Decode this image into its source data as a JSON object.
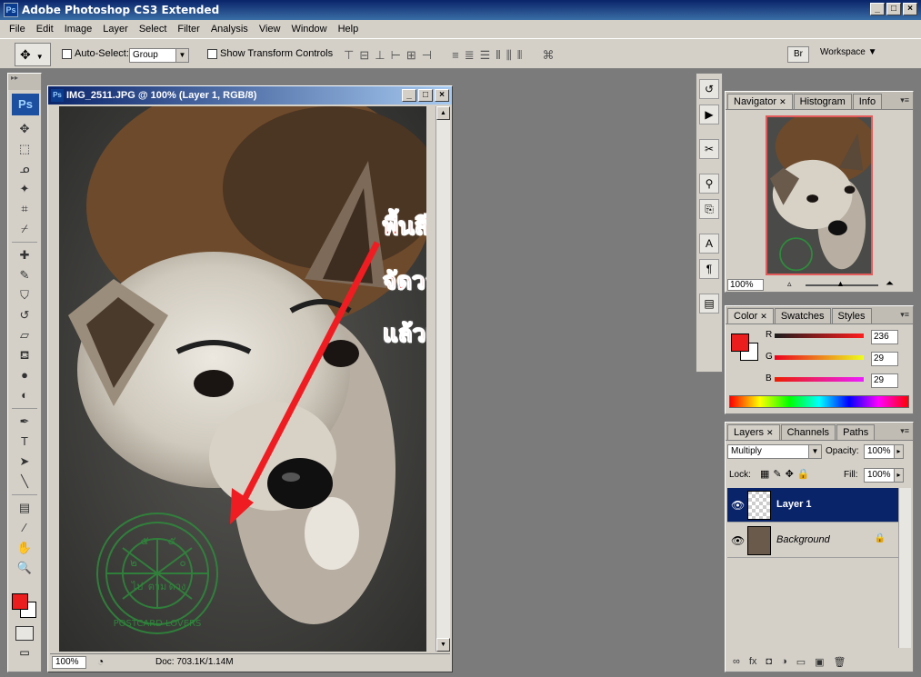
{
  "window": {
    "title": "Adobe Photoshop CS3 Extended",
    "ps_badge": "Ps",
    "minimize": "_",
    "maximize": "□",
    "close": "×"
  },
  "menu": [
    "File",
    "Edit",
    "Image",
    "Layer",
    "Select",
    "Filter",
    "Analysis",
    "View",
    "Window",
    "Help"
  ],
  "options": {
    "auto_select_label": "Auto-Select:",
    "auto_select_value": "Group",
    "show_transform_label": "Show Transform Controls",
    "workspace_label": "Workspace ▼"
  },
  "toolbox": {
    "logo": "Ps",
    "tools": [
      {
        "icon": "move-icon",
        "glyph": "✥"
      },
      {
        "icon": "marquee-icon",
        "glyph": "⬚"
      },
      {
        "icon": "lasso-icon",
        "glyph": "ᓄ"
      },
      {
        "icon": "magic-wand-icon",
        "glyph": "✦"
      },
      {
        "icon": "crop-icon",
        "glyph": "⌗"
      },
      {
        "icon": "slice-icon",
        "glyph": "⌿"
      },
      {
        "icon": "healing-brush-icon",
        "glyph": "✚"
      },
      {
        "icon": "brush-icon",
        "glyph": "✎"
      },
      {
        "icon": "clone-stamp-icon",
        "glyph": "⛉"
      },
      {
        "icon": "history-brush-icon",
        "glyph": "↺"
      },
      {
        "icon": "eraser-icon",
        "glyph": "▱"
      },
      {
        "icon": "paint-bucket-icon",
        "glyph": "⛾"
      },
      {
        "icon": "blur-icon",
        "glyph": "●"
      },
      {
        "icon": "dodge-icon",
        "glyph": "◐"
      },
      {
        "icon": "pen-icon",
        "glyph": "✒"
      },
      {
        "icon": "type-icon",
        "glyph": "T"
      },
      {
        "icon": "path-selection-icon",
        "glyph": "➤"
      },
      {
        "icon": "line-icon",
        "glyph": "╲"
      },
      {
        "icon": "notes-icon",
        "glyph": "▤"
      },
      {
        "icon": "eyedropper-icon",
        "glyph": "⁄"
      },
      {
        "icon": "hand-icon",
        "glyph": "✋"
      },
      {
        "icon": "zoom-icon",
        "glyph": "🔍"
      }
    ]
  },
  "document": {
    "title": "IMG_2511.JPG @ 100% (Layer 1, RGB/8)",
    "zoom": "100%",
    "doc_size": "Doc: 703.1K/1.14M",
    "annotations": [
      "พื้นสีขาวจะหายไป",
      "จัดวางโลโก้ให้สวยงาม",
      "แล้วเซฟตามปกติ"
    ],
    "stamp": {
      "numbers": [
        "๒",
        "๕",
        "๕",
        "๐"
      ],
      "words": [
        "ไป",
        "ตาม",
        "ดวง"
      ],
      "ring_text": "POSTCARD LOVERS"
    }
  },
  "navigator": {
    "tabs": [
      "Navigator",
      "Histogram",
      "Info"
    ],
    "zoom": "100%"
  },
  "color": {
    "tabs": [
      "Color",
      "Swatches",
      "Styles"
    ],
    "fg_color": "#ec1d1d",
    "channels": [
      {
        "label": "R",
        "value": "236"
      },
      {
        "label": "G",
        "value": "29"
      },
      {
        "label": "B",
        "value": "29"
      }
    ]
  },
  "layers": {
    "tabs": [
      "Layers",
      "Channels",
      "Paths"
    ],
    "blend_mode": "Multiply",
    "opacity_label": "Opacity:",
    "opacity": "100%",
    "lock_label": "Lock:",
    "fill_label": "Fill:",
    "fill": "100%",
    "items": [
      {
        "name": "Layer 1",
        "selected": true
      },
      {
        "name": "Background",
        "selected": false
      }
    ]
  }
}
